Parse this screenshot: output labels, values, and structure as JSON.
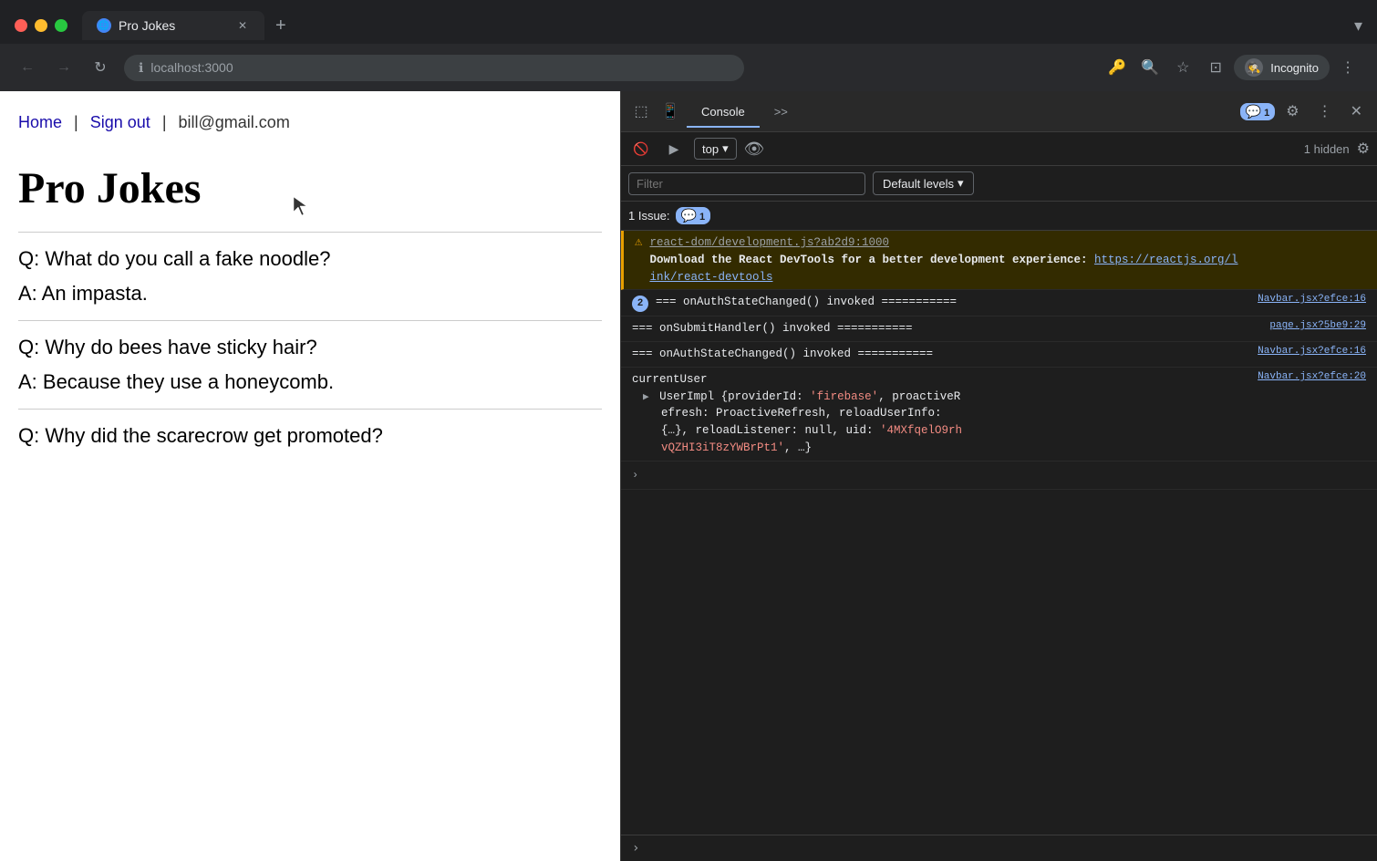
{
  "browser": {
    "tab_title": "Pro Jokes",
    "url_scheme": "localhost",
    "url_port": ":3000",
    "new_tab_label": "+",
    "tab_list_label": "▾",
    "nav": {
      "back_label": "←",
      "forward_label": "→",
      "reload_label": "↻"
    },
    "toolbar_icons": [
      "🔑",
      "🔍",
      "☆",
      "⊡"
    ],
    "incognito_label": "Incognito"
  },
  "page": {
    "nav_home": "Home",
    "nav_separator1": "|",
    "nav_signout": "Sign out",
    "nav_separator2": "|",
    "nav_email": "bill@gmail.com",
    "title": "Pro Jokes",
    "jokes": [
      {
        "question": "Q: What do you call a fake noodle?",
        "answer": "A: An impasta."
      },
      {
        "question": "Q: Why do bees have sticky hair?",
        "answer": "A: Because they use a honeycomb."
      },
      {
        "question": "Q: Why did the scarecrow get promoted?",
        "answer": ""
      }
    ]
  },
  "devtools": {
    "tabs": [
      "Console",
      ">>"
    ],
    "active_tab": "Console",
    "badge_count": "1",
    "top_label": "top",
    "hidden_label": "1 hidden",
    "filter_placeholder": "Filter",
    "levels_label": "Default levels",
    "issues_label": "1 Issue:",
    "issues_count": "1",
    "console_lines": [
      {
        "type": "warning",
        "badge": null,
        "content": "react-dom/development.js?ab2d9:1000",
        "content2": "Download the React DevTools for a better development experience: https://reactjs.org/link/react-devtools",
        "link": "https://reactjs.org/link/react-devtools",
        "source": null
      },
      {
        "type": "log",
        "badge": "2",
        "badge_color": "blue",
        "content": "=== onAuthStateChanged() invoked ===========",
        "source": "Navbar.jsx?efce:16"
      },
      {
        "type": "log",
        "badge": null,
        "content": "=== onSubmitHandler() invoked ===========",
        "source": "page.jsx?5be9:29"
      },
      {
        "type": "log",
        "badge": null,
        "content": "=== onAuthStateChanged() invoked ===========",
        "source": "Navbar.jsx?efce:16"
      },
      {
        "type": "log",
        "badge": null,
        "content_prefix": "currentUser",
        "content_obj": "UserImpl {providerId: 'firebase', proactiveRefresh: ProactiveRefresh, reloadUserInfo: {…}, reloadListener: null, uid: '4MXfqelO9rhvQZHI3iT8zYWBrPt1', …}",
        "source": "Navbar.jsx?efce:20",
        "provider_id": "'firebase'",
        "uid_val": "'4MXfqelO9rhvQZHI3iT8zYWBrPt1'"
      }
    ],
    "expand_arrow_label": "›"
  }
}
